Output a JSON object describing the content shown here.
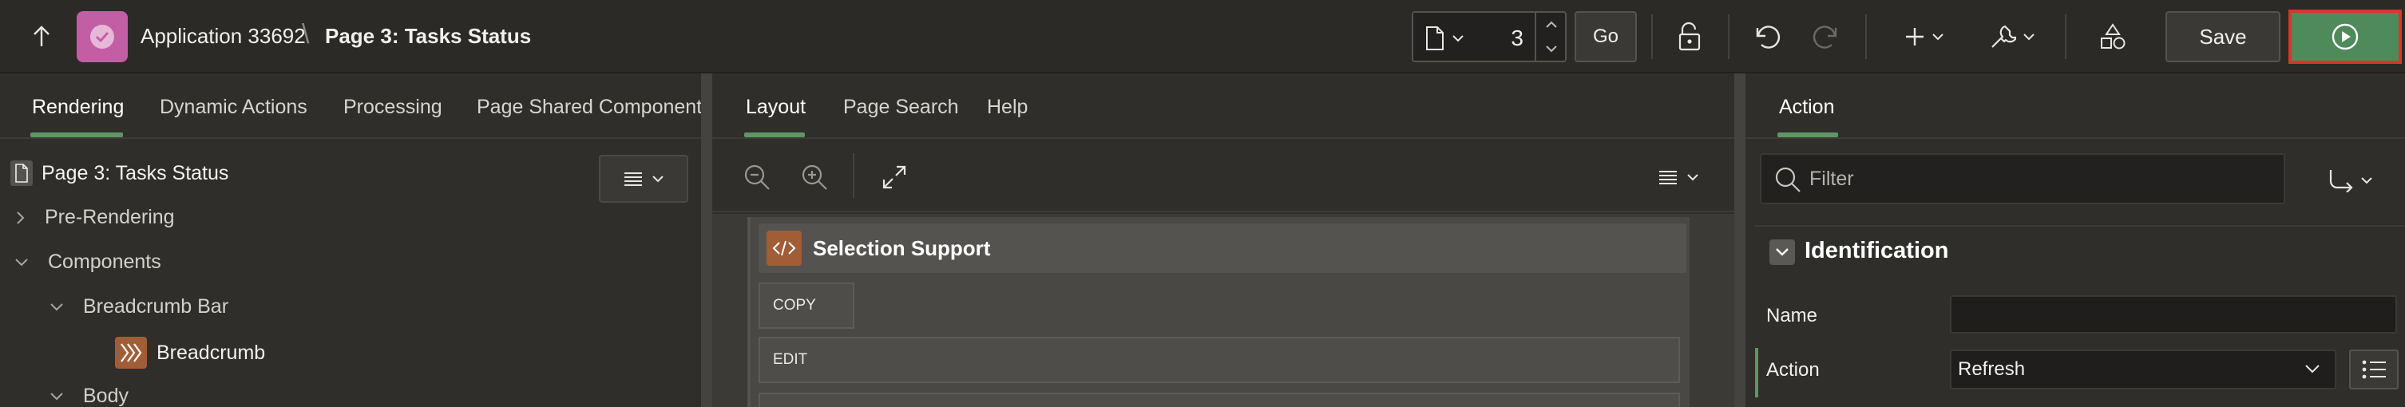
{
  "header": {
    "app_name": "Application 33692",
    "separator": "\\",
    "page_name": "Page 3: Tasks Status",
    "page_number": "3",
    "go_label": "Go",
    "save_label": "Save",
    "icons": [
      "arrow-up-icon",
      "app-check-icon",
      "page-doc-icon",
      "lock-icon",
      "undo-icon",
      "redo-icon",
      "plus-icon",
      "wrench-icon",
      "shapes-icon",
      "run-icon"
    ],
    "colors": {
      "app_icon": "#c25fa4",
      "run_button": "#4f8a5a",
      "run_highlight": "#d9352b"
    }
  },
  "left_panel": {
    "tabs": [
      {
        "label": "Rendering",
        "active": true
      },
      {
        "label": "Dynamic Actions",
        "active": false
      },
      {
        "label": "Processing",
        "active": false
      },
      {
        "label": "Page Shared Components",
        "active": false
      }
    ],
    "tree": {
      "root": "Page 3: Tasks Status",
      "items": [
        {
          "label": "Pre-Rendering",
          "expanded": false
        },
        {
          "label": "Components",
          "expanded": true
        },
        {
          "label": "Breadcrumb Bar",
          "expanded": true
        },
        {
          "label": "Breadcrumb",
          "icon": "breadcrumb-icon"
        },
        {
          "label": "Body",
          "expanded": true
        }
      ]
    }
  },
  "middle_panel": {
    "tabs": [
      {
        "label": "Layout",
        "active": true
      },
      {
        "label": "Page Search",
        "active": false
      },
      {
        "label": "Help",
        "active": false
      }
    ],
    "region": {
      "title": "Selection Support",
      "buttons": [
        "COPY",
        "EDIT"
      ]
    }
  },
  "right_panel": {
    "tabs": [
      {
        "label": "Action",
        "active": true
      }
    ],
    "filter_placeholder": "Filter",
    "section_title": "Identification",
    "properties": [
      {
        "label": "Name",
        "value": ""
      },
      {
        "label": "Action",
        "value": "Refresh"
      }
    ]
  }
}
